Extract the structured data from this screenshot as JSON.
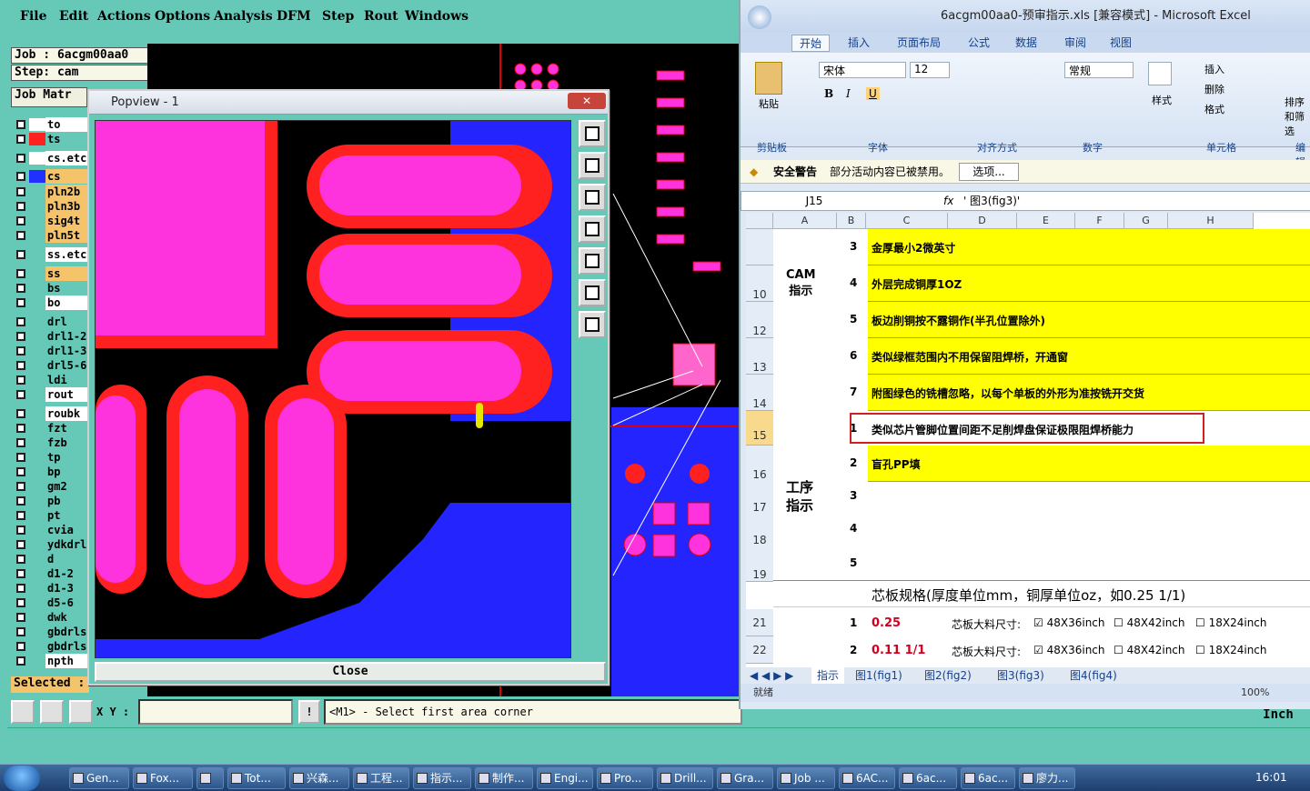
{
  "menu": [
    "File",
    "Edit",
    "Actions",
    "Options",
    "Analysis",
    "DFM",
    "Step",
    "Rout",
    "Windows"
  ],
  "job_label": "Job : 6acgm00aa0",
  "step_label": "Step: cam",
  "job_matrix_label": "Job Matr",
  "layers": [
    {
      "name": "to",
      "color": "#ffffff",
      "style": "w"
    },
    {
      "name": "ts",
      "color": "#ff2020",
      "style": "dk"
    },
    {
      "name": "cs.etc",
      "color": "#ffffff",
      "style": "w"
    },
    {
      "name": "cs",
      "color": "#2030ff",
      "style": "or"
    },
    {
      "name": "pln2b",
      "color": "",
      "style": "or"
    },
    {
      "name": "pln3b",
      "color": "",
      "style": "or"
    },
    {
      "name": "sig4t",
      "color": "",
      "style": "or"
    },
    {
      "name": "pln5t",
      "color": "",
      "style": "or"
    },
    {
      "name": "ss.etc",
      "color": "",
      "style": "w"
    },
    {
      "name": "ss",
      "color": "",
      "style": "or"
    },
    {
      "name": "bs",
      "color": "",
      "style": "dk"
    },
    {
      "name": "bo",
      "color": "",
      "style": "w"
    },
    {
      "name": "drl",
      "color": "",
      "style": "dk"
    },
    {
      "name": "drl1-2",
      "color": "",
      "style": "dk"
    },
    {
      "name": "drl1-3",
      "color": "",
      "style": "dk"
    },
    {
      "name": "drl5-6",
      "color": "",
      "style": "dk"
    },
    {
      "name": "ldi",
      "color": "",
      "style": "dk"
    },
    {
      "name": "rout",
      "color": "",
      "style": "w"
    },
    {
      "name": "roubk",
      "color": "",
      "style": "w"
    },
    {
      "name": "fzt",
      "color": "",
      "style": "dk"
    },
    {
      "name": "fzb",
      "color": "",
      "style": "dk"
    },
    {
      "name": "tp",
      "color": "",
      "style": "dk"
    },
    {
      "name": "bp",
      "color": "",
      "style": "dk"
    },
    {
      "name": "gm2",
      "color": "",
      "style": "dk"
    },
    {
      "name": "pb",
      "color": "",
      "style": "dk"
    },
    {
      "name": "pt",
      "color": "",
      "style": "dk"
    },
    {
      "name": "cvia",
      "color": "",
      "style": "dk"
    },
    {
      "name": "ydkdrl",
      "color": "",
      "style": "dk"
    },
    {
      "name": "d",
      "color": "",
      "style": "dk"
    },
    {
      "name": "d1-2",
      "color": "",
      "style": "dk"
    },
    {
      "name": "d1-3",
      "color": "",
      "style": "dk"
    },
    {
      "name": "d5-6",
      "color": "",
      "style": "dk"
    },
    {
      "name": "dwk",
      "color": "",
      "style": "dk"
    },
    {
      "name": "gbdrls",
      "color": "",
      "style": "dk"
    },
    {
      "name": "gbdrls",
      "color": "",
      "style": "dk"
    },
    {
      "name": "npth",
      "color": "",
      "style": "w"
    }
  ],
  "selected_label": "Selected :",
  "popview": {
    "title": "Popview - 1",
    "close_label": "Close"
  },
  "status": {
    "xy_label": "X Y :",
    "prompt": "<M1> - Select first area corner",
    "unit": "Inch"
  },
  "excel": {
    "title": "6acgm00aa0-预审指示.xls [兼容模式] - Microsoft Excel",
    "tabs": [
      "开始",
      "插入",
      "页面布局",
      "公式",
      "数据",
      "审阅",
      "视图"
    ],
    "clipboard": "剪贴板",
    "paste": "粘贴",
    "font_group": "字体",
    "align_group": "对齐方式",
    "number_group": "数字",
    "styles": "样式",
    "cells_group": "单元格",
    "edit_group": "编辑",
    "font_name": "宋体",
    "font_size": "12",
    "number_format": "常规",
    "insert": "插入",
    "delete": "删除",
    "format": "格式",
    "sort": "排序和筛选",
    "security_warning": "安全警告",
    "security_text": "部分活动内容已被禁用。",
    "options_btn": "选项...",
    "name_box": "J15",
    "formula": "' 图3(fig3)'",
    "columns": [
      "A",
      "B",
      "C",
      "D",
      "E",
      "F",
      "G",
      "H"
    ],
    "rows": [
      {
        "row": "",
        "num": "3",
        "text": "金厚最小2微英寸",
        "yellow": true
      },
      {
        "row": "10 11",
        "num": "4",
        "text": "外层完成铜厚1OZ",
        "yellow": true
      },
      {
        "row": "12",
        "num": "5",
        "text": "板边削铜按不露铜作(半孔位置除外)",
        "yellow": true
      },
      {
        "row": "13",
        "num": "6",
        "text": "类似绿框范围内不用保留阻焊桥，开通窗",
        "yellow": true
      },
      {
        "row": "14",
        "num": "7",
        "text": "附图绿色的铣槽忽略，以每个单板的外形为准按铣开交货",
        "yellow": true
      },
      {
        "row": "15",
        "num": "1",
        "text": "类似芯片管脚位置间距不足削焊盘保证极限阻焊桥能力",
        "yellow": false
      },
      {
        "row": "16",
        "num": "2",
        "text": "盲孔PP填",
        "yellow": true
      },
      {
        "row": "17",
        "num": "3",
        "text": "",
        "yellow": false
      },
      {
        "row": "18",
        "num": "4",
        "text": "",
        "yellow": false
      },
      {
        "row": "19",
        "num": "5",
        "text": "",
        "yellow": false
      }
    ],
    "cam_label": "CAM\n指示",
    "process_label": "工序\n指示",
    "core_title": "芯板规格(厚度单位mm，铜厚单位oz，如0.25 1/1)",
    "core_rows": [
      {
        "row": "21",
        "num": "1",
        "val": "0.25",
        "size_label": "芯板大料尺寸:",
        "o1": "48X36inch",
        "o2": "48X42inch",
        "o3": "18X24inch"
      },
      {
        "row": "22",
        "num": "2",
        "val": "0.11 1/1",
        "size_label": "芯板大料尺寸:",
        "o1": "48X36inch",
        "o2": "48X42inch",
        "o3": "18X24inch"
      }
    ],
    "sheets": [
      "指示",
      "图1(fig1)",
      "图2(fig2)",
      "图3(fig3)",
      "图4(fig4)"
    ],
    "status_ready": "就绪",
    "zoom": "100%"
  },
  "taskbar": {
    "items": [
      "Gen...",
      "Fox...",
      "",
      "Tot...",
      "兴森...",
      "工程...",
      "指示...",
      "制作...",
      "Engi...",
      "Pro...",
      "Drill...",
      "Gra...",
      "Job ...",
      "6AC...",
      "6ac...",
      "6ac...",
      "廖力..."
    ],
    "clock": "16:01"
  }
}
